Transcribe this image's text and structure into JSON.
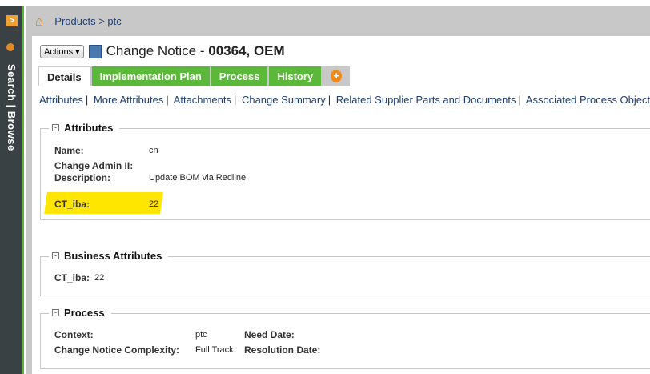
{
  "sidebar": {
    "label": "Search | Browse"
  },
  "breadcrumb": {
    "text": "Products > ptc"
  },
  "header": {
    "actions_label": "Actions",
    "title_prefix": "Change Notice - ",
    "title_id": "00364, OEM"
  },
  "tabs": [
    {
      "label": "Details"
    },
    {
      "label": "Implementation Plan"
    },
    {
      "label": "Process"
    },
    {
      "label": "History"
    }
  ],
  "sublinks": [
    "Attributes",
    "More Attributes",
    "Attachments",
    "Change Summary",
    "Related Supplier Parts and Documents",
    "Associated Process Objects"
  ],
  "attributes": {
    "title": "Attributes",
    "name_label": "Name:",
    "name_value": "cn",
    "admin_label": "Change Admin II:",
    "desc_label": "Description:",
    "desc_value": "Update BOM via Redline",
    "ct_label": "CT_iba:",
    "ct_value": "22"
  },
  "business": {
    "title": "Business Attributes",
    "ct_label": "CT_iba:",
    "ct_value": "22"
  },
  "process": {
    "title": "Process",
    "context_label": "Context:",
    "context_value": "ptc",
    "complexity_label": "Change Notice Complexity:",
    "complexity_value": "Full Track",
    "need_label": "Need Date:",
    "resolution_label": "Resolution Date:"
  }
}
